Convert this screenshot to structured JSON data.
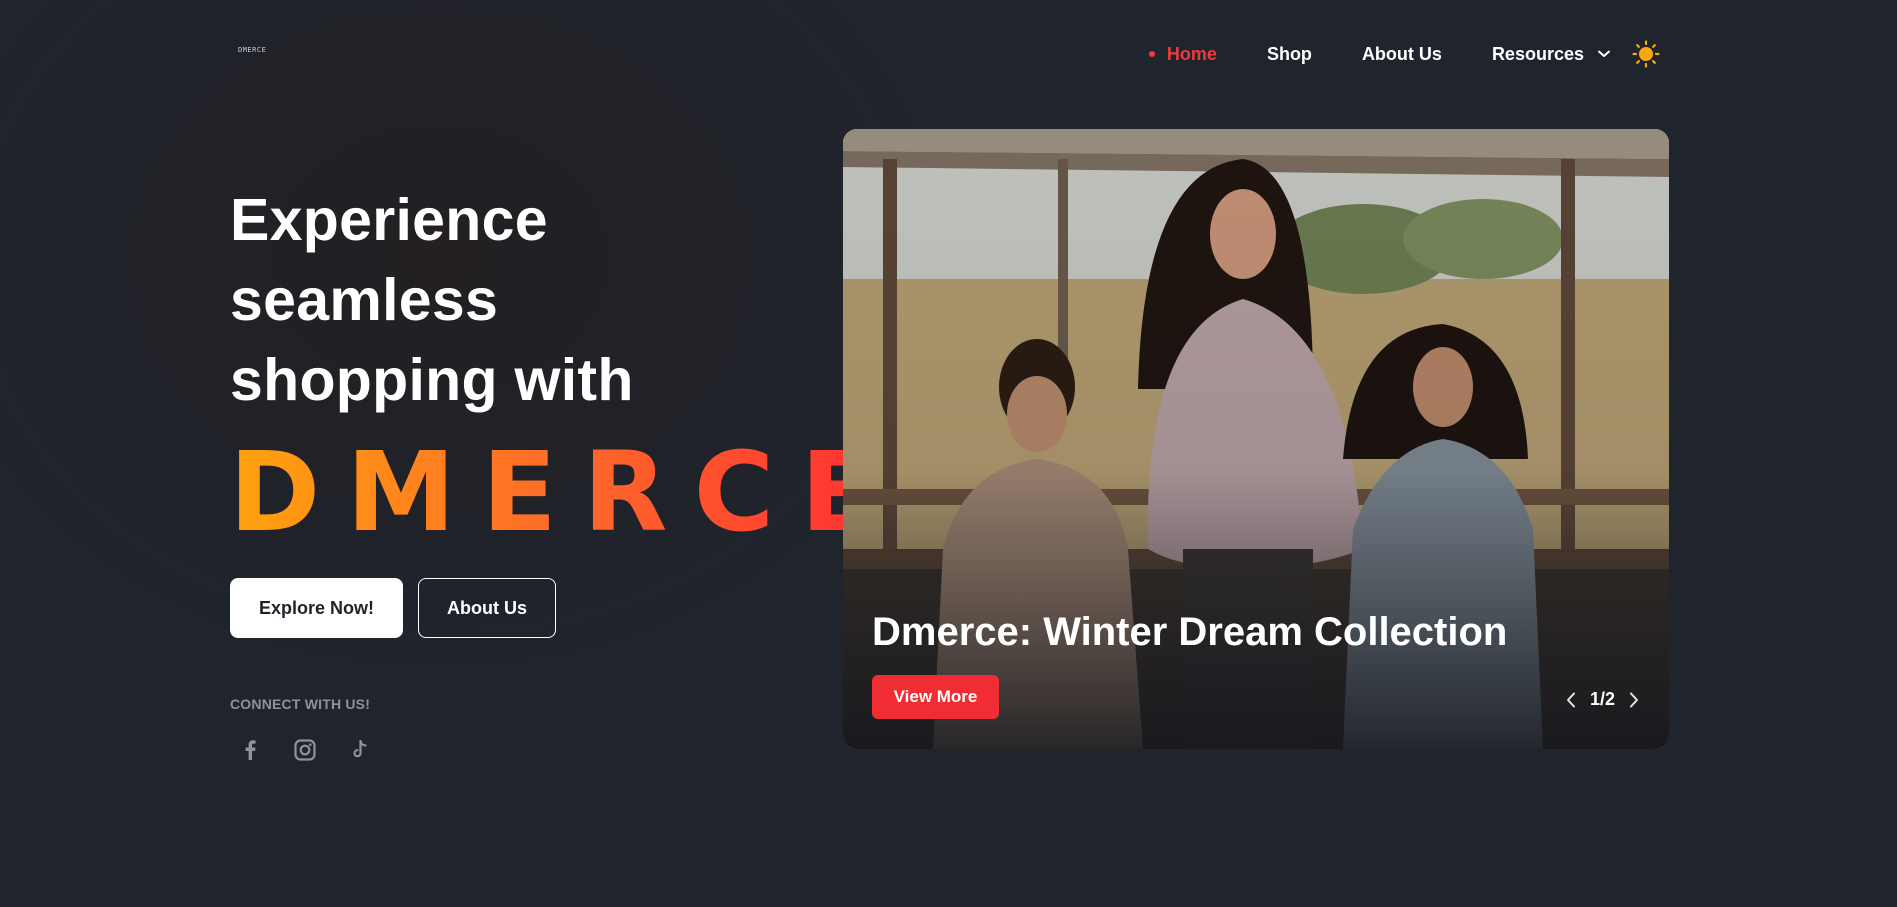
{
  "logo": {
    "text": "DMERCE"
  },
  "nav": {
    "items": [
      {
        "label": "Home",
        "active": true
      },
      {
        "label": "Shop"
      },
      {
        "label": "About Us"
      },
      {
        "label": "Resources",
        "has_dropdown": true
      }
    ],
    "theme_toggle_icon": "sun-icon"
  },
  "hero": {
    "headline_lines": [
      "Experience",
      "seamless",
      "shopping with"
    ],
    "brand": "DMERCE",
    "buttons": {
      "primary": "Explore Now!",
      "secondary": "About Us"
    },
    "connect_label": "CONNECT WITH US!",
    "socials": [
      "facebook-icon",
      "instagram-icon",
      "tiktok-icon"
    ]
  },
  "carousel": {
    "title": "Dmerce: Winter Dream Collection",
    "button": "View More",
    "pager": "1/2"
  },
  "colors": {
    "accent": "#ef3a3a",
    "button_red": "#ef2d32",
    "brand_gradient": [
      "#ffa20d",
      "#ff2e32"
    ],
    "sun": "#f7a711",
    "background": "#1f242c"
  }
}
